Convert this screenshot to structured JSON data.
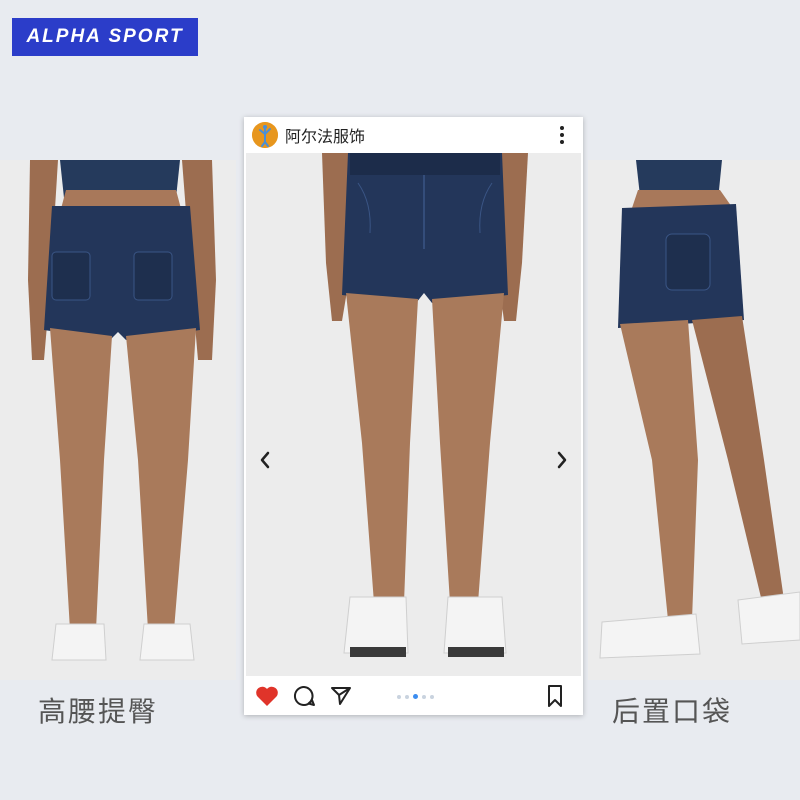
{
  "brand": {
    "name": "ALPHA SPORT",
    "color": "#2b3dc9"
  },
  "left_panel": {
    "caption": "高腰提臀"
  },
  "right_panel": {
    "caption": "后置口袋"
  },
  "post": {
    "username": "阿尔法服饰",
    "avatar_icon": "dancer-avatar-icon",
    "more_icon": "more-vertical-icon",
    "carousel": {
      "slide_count": 5,
      "active_index": 2
    },
    "actions": {
      "like_icon": "heart-icon",
      "like_color": "#e0342a",
      "comment_icon": "comment-icon",
      "share_icon": "send-icon",
      "save_icon": "bookmark-icon"
    },
    "prev_icon": "chevron-left-icon",
    "next_icon": "chevron-right-icon"
  }
}
